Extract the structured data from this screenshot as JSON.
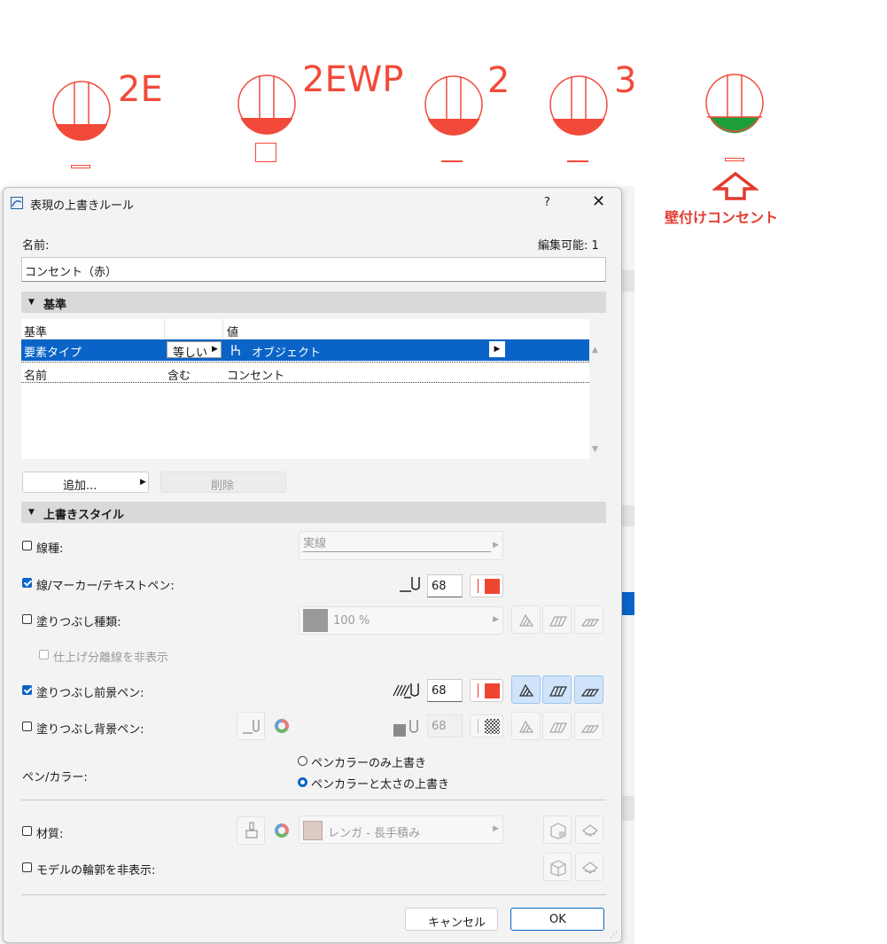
{
  "canvas": {
    "labels": [
      "2E",
      "2EWP",
      "2",
      "3"
    ],
    "wall_note": "壁付けコンセント",
    "symbol_color": "#f24a3a",
    "green_fill": "#1e9e3a"
  },
  "dialog": {
    "title": "表現の上書きルール",
    "help": "?",
    "close": "✕",
    "name_label": "名前:",
    "editable_label": "編集可能: 1",
    "name_value": "コンセント（赤）",
    "criteria_section": "基準",
    "criteria_table": {
      "headers": [
        "基準",
        "値"
      ],
      "rows": [
        {
          "criterion": "要素タイプ",
          "operator": "等しい",
          "value": "オブジェクト"
        },
        {
          "criterion": "名前",
          "operator": "含む",
          "value": "コンセント"
        }
      ]
    },
    "add_button": "追加...",
    "delete_button": "削除",
    "override_section": "上書きスタイル",
    "line_type_label": "線種:",
    "line_type_value": "実線",
    "line_pen_label": "線/マーカー/テキストペン:",
    "line_pen_value": "68",
    "fill_type_label": "塗りつぶし種類:",
    "fill_type_value": "100 %",
    "hide_finish_label": "仕上げ分離線を非表示",
    "fill_fg_label": "塗りつぶし前景ペン:",
    "fill_fg_value": "68",
    "fill_bg_label": "塗りつぶし背景ペン:",
    "fill_bg_value": "68",
    "pen_color_label": "ペン/カラー:",
    "radio_pen_only": "ペンカラーのみ上書き",
    "radio_pen_weight": "ペンカラーと太さの上書き",
    "material_label": "材質:",
    "material_value": "レンガ - 長手積み",
    "hide_contour_label": "モデルの輪郭を非表示:",
    "cancel_button": "キャンセル",
    "ok_button": "OK",
    "accent_color": "#0a64c8",
    "pen_color": "#f04433"
  }
}
